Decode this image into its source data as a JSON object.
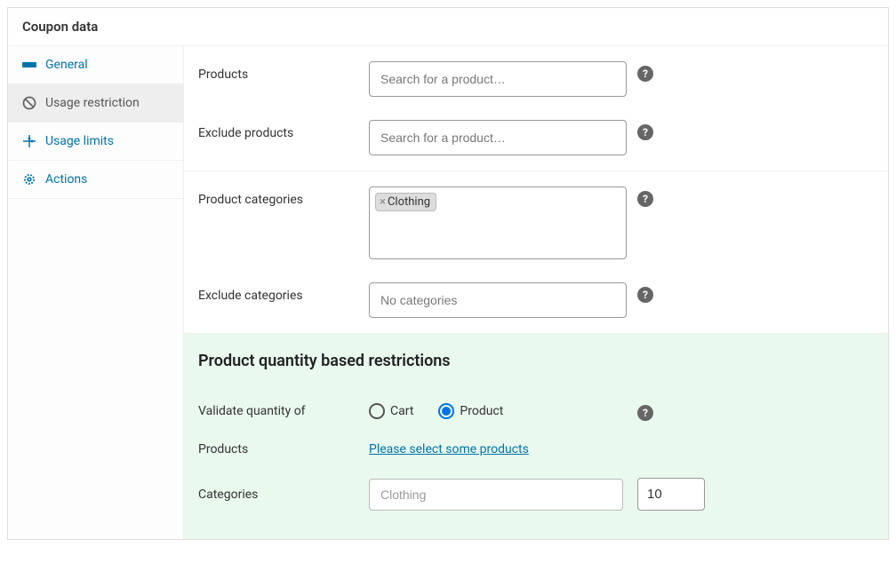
{
  "panel": {
    "title": "Coupon data"
  },
  "sidebar": {
    "items": [
      {
        "label": "General",
        "icon": "ticket-icon"
      },
      {
        "label": "Usage restriction",
        "icon": "ban-icon",
        "active": true
      },
      {
        "label": "Usage limits",
        "icon": "sliders-icon"
      },
      {
        "label": "Actions",
        "icon": "gear-icon"
      }
    ]
  },
  "fields": {
    "products": {
      "label": "Products",
      "placeholder": "Search for a product…"
    },
    "exclude_products": {
      "label": "Exclude products",
      "placeholder": "Search for a product…"
    },
    "product_categories": {
      "label": "Product categories",
      "tag": "Clothing"
    },
    "exclude_categories": {
      "label": "Exclude categories",
      "placeholder": "No categories"
    }
  },
  "qty": {
    "heading": "Product quantity based restrictions",
    "validate_label": "Validate quantity of",
    "radio_cart": "Cart",
    "radio_product": "Product",
    "products_label": "Products",
    "products_link": "Please select some products",
    "categories_label": "Categories",
    "categories_value": "Clothing",
    "number_value": "10"
  }
}
